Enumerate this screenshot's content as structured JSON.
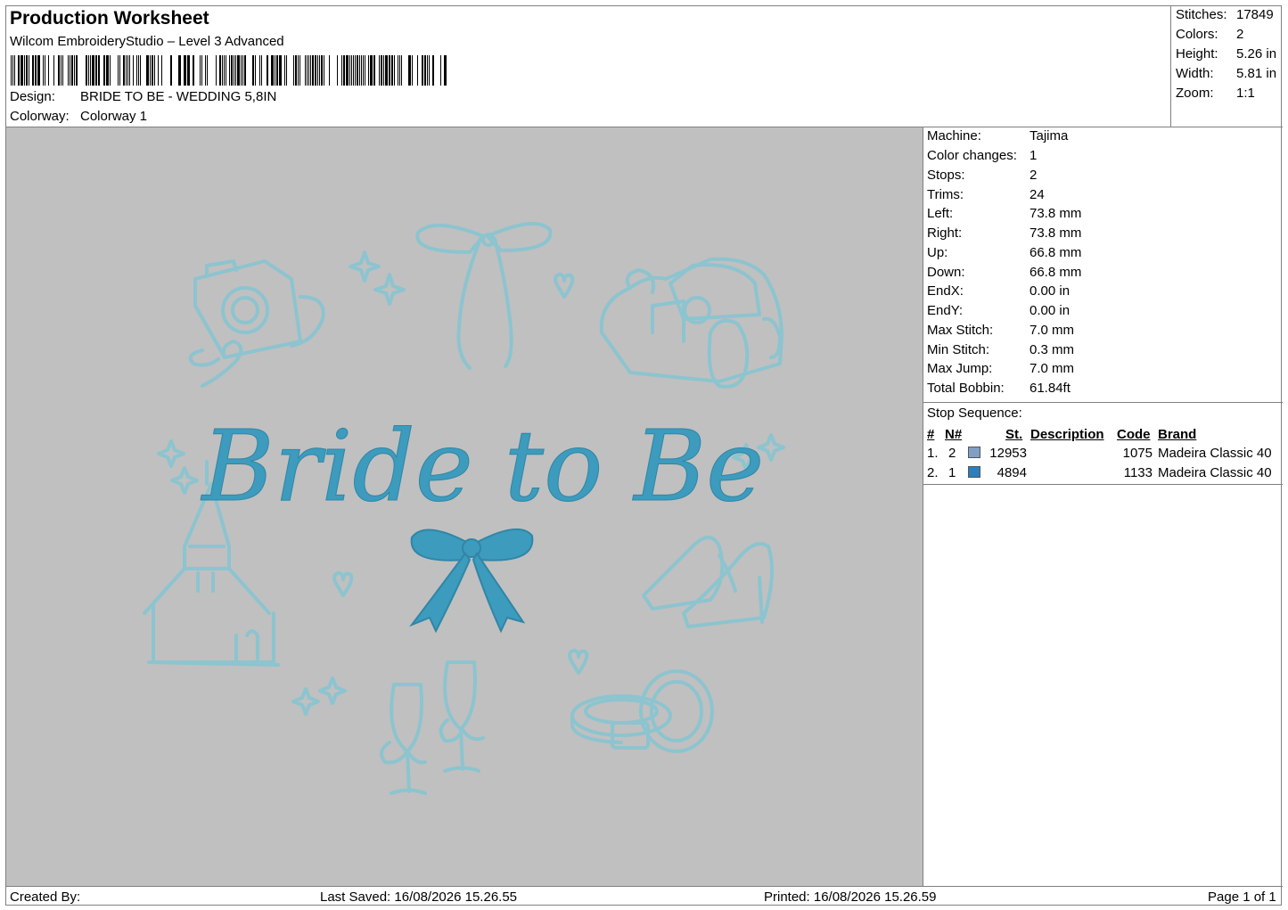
{
  "header": {
    "title": "Production Worksheet",
    "subtitle": "Wilcom EmbroideryStudio – Level 3 Advanced",
    "design_label": "Design:",
    "design_value": "BRIDE TO BE - WEDDING 5,8IN",
    "colorway_label": "Colorway:",
    "colorway_value": "Colorway 1"
  },
  "stats": [
    {
      "label": "Stitches:",
      "value": "17849"
    },
    {
      "label": "Colors:",
      "value": "2"
    },
    {
      "label": "Height:",
      "value": "5.26 in"
    },
    {
      "label": "Width:",
      "value": "5.81 in"
    },
    {
      "label": "Zoom:",
      "value": "1:1"
    }
  ],
  "machine_info": [
    {
      "label": "Machine:",
      "value": "Tajima"
    },
    {
      "label": "Color changes:",
      "value": "1"
    },
    {
      "label": "Stops:",
      "value": "2"
    },
    {
      "label": "Trims:",
      "value": "24"
    },
    {
      "label": "Left:",
      "value": "73.8 mm"
    },
    {
      "label": "Right:",
      "value": "73.8 mm"
    },
    {
      "label": "Up:",
      "value": "66.8 mm"
    },
    {
      "label": "Down:",
      "value": "66.8 mm"
    },
    {
      "label": "EndX:",
      "value": "0.00 in"
    },
    {
      "label": "EndY:",
      "value": "0.00 in"
    },
    {
      "label": "Max Stitch:",
      "value": "7.0 mm"
    },
    {
      "label": "Min Stitch:",
      "value": "0.3 mm"
    },
    {
      "label": "Max Jump:",
      "value": "7.0 mm"
    },
    {
      "label": "Total Bobbin:",
      "value": "61.84ft"
    }
  ],
  "stop_sequence": {
    "title": "Stop Sequence:",
    "columns": {
      "num": "#",
      "needle": "N#",
      "stitches": "St.",
      "description": "Description",
      "code": "Code",
      "brand": "Brand"
    },
    "rows": [
      {
        "num": "1.",
        "needle": "2",
        "color": "#7f9fc4",
        "stitches": "12953",
        "description": "",
        "code": "1075",
        "brand": "Madeira Classic 40"
      },
      {
        "num": "2.",
        "needle": "1",
        "color": "#2b7fbd",
        "stitches": "4894",
        "description": "",
        "code": "1133",
        "brand": "Madeira Classic 40"
      }
    ]
  },
  "design_preview": {
    "text": "Bride to Be",
    "outline_color": "#8cc4cf",
    "fill_color": "#3d9bbd",
    "background": "#c0c0c0"
  },
  "footer": {
    "created_by": "Created By:",
    "last_saved": "Last Saved: 16/08/2026 15.26.55",
    "printed": "Printed: 16/08/2026 15.26.59",
    "page": "Page 1 of 1"
  }
}
